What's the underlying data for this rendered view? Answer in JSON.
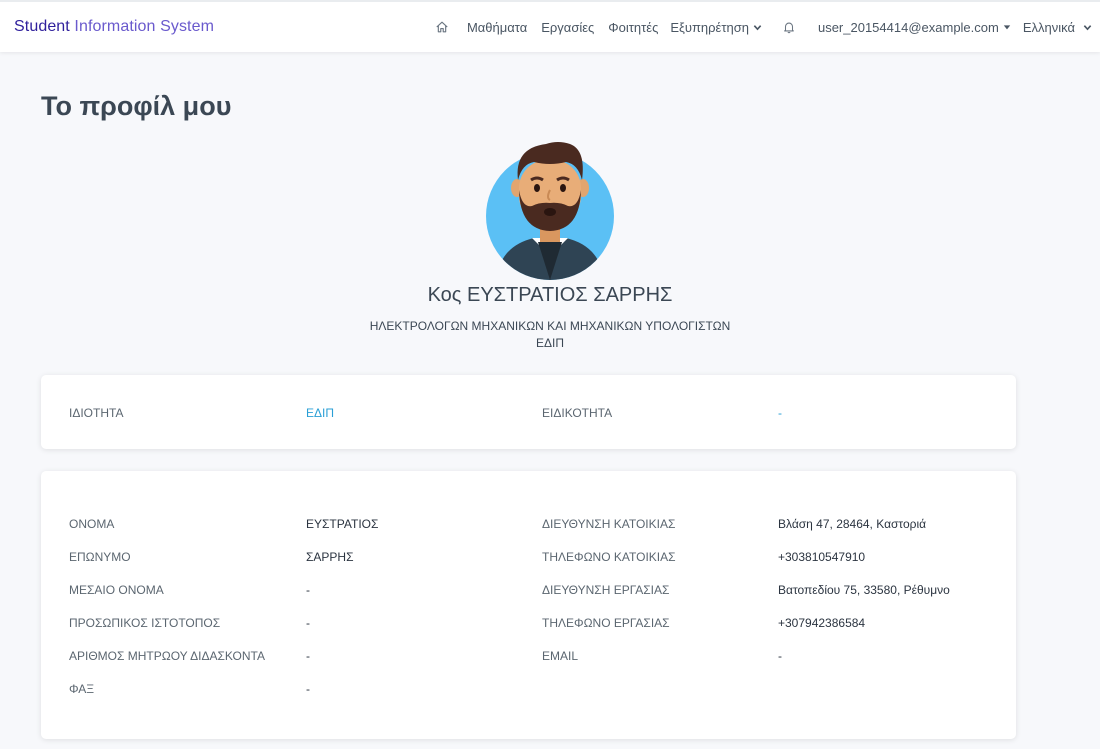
{
  "brand": {
    "part1": "Student",
    "part2": "Information System"
  },
  "nav": {
    "home_icon": "home-icon",
    "courses": "Μαθήματα",
    "assignments": "Εργασίες",
    "students": "Φοιτητές",
    "service": "Εξυπηρέτηση",
    "bell_icon": "bell-icon",
    "user": "user_20154414@example.com",
    "language": "Ελληνικά"
  },
  "page": {
    "title": "Το προφίλ μου"
  },
  "profile": {
    "avatar_icon": "avatar-icon",
    "name": "Κος ΕΥΣΤΡΑΤΙΟΣ ΣΑΡΡΗΣ",
    "department": "ΗΛΕΚΤΡΟΛΟΓΩΝ ΜΗΧΑΝΙΚΩΝ ΚΑΙ ΜΗΧΑΝΙΚΩΝ ΥΠΟΛΟΓΙΣΤΩΝ",
    "role": "ΕΔΙΠ"
  },
  "summary": {
    "property_label": "ΙΔΙΟΤΗΤΑ",
    "property_value": "ΕΔΙΠ",
    "specialty_label": "ΕΙΔΙΚΟΤΗΤΑ",
    "specialty_value": "-"
  },
  "details": {
    "first_name_label": "ΟΝΟΜΑ",
    "first_name": "ΕΥΣΤΡΑΤΙΟΣ",
    "last_name_label": "ΕΠΩΝΥΜΟ",
    "last_name": "ΣΑΡΡΗΣ",
    "middle_name_label": "ΜΕΣΑΙΟ ΟΝΟΜΑ",
    "middle_name": "-",
    "website_label": "ΠΡΟΣΩΠΙΚΟΣ ΙΣΤΟΤΟΠΟΣ",
    "website": "-",
    "reg_no_label": "ΑΡΙΘΜΟΣ ΜΗΤΡΩΟΥ ΔΙΔΑΣΚΟΝΤΑ",
    "reg_no": "-",
    "fax_label": "ΦΑΞ",
    "fax": "-",
    "home_address_label": "ΔΙΕΥΘΥΝΣΗ ΚΑΤΟΙΚΙΑΣ",
    "home_address": "Βλάση 47, 28464, Καστοριά",
    "home_phone_label": "ΤΗΛΕΦΩΝΟ ΚΑΤΟΙΚΙΑΣ",
    "home_phone": "+303810547910",
    "work_address_label": "ΔΙΕΥΘΥΝΣΗ ΕΡΓΑΣΙΑΣ",
    "work_address": "Βατοπεδίου 75, 33580, Ρέθυμνο",
    "work_phone_label": "ΤΗΛΕΦΩΝΟ ΕΡΓΑΣΙΑΣ",
    "work_phone": "+307942386584",
    "email_label": "EMAIL",
    "email": "-"
  },
  "colors": {
    "brand": "#2f1f9c",
    "link": "#2a9fd6",
    "avatar_bg": "#5bc0f5"
  }
}
